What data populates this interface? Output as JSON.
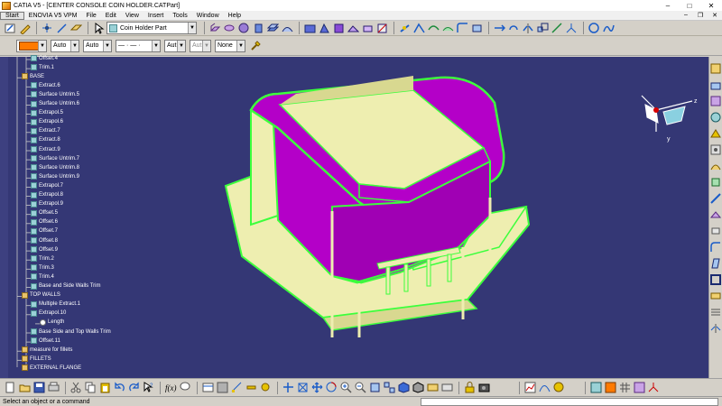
{
  "titlebar": {
    "title": "CATIA V5 - [CENTER CONSOLE COIN HOLDER.CATPart]",
    "minimize": "–",
    "maximize": "□",
    "close": "✕"
  },
  "menubar": {
    "items": [
      "Start",
      "ENOVIA V5 VPM",
      "File",
      "Edit",
      "View",
      "Insert",
      "Tools",
      "Window",
      "Help"
    ],
    "mdi_minimize": "–",
    "mdi_restore": "❐",
    "mdi_close": "✕"
  },
  "toolbar": {
    "part_combo_value": "Coin Holder Part"
  },
  "properties_bar": {
    "color_value": "",
    "transparency_value": "Auto",
    "line_weight_value": "Auto",
    "line_type_value": "— · — ·",
    "point_symbol_value": "Aut",
    "rendering_value": "Aut",
    "layer_value": "None"
  },
  "tree": {
    "nodes": [
      {
        "label": "Offset.4",
        "type": "feat"
      },
      {
        "label": "Trim.1",
        "type": "feat"
      },
      {
        "label": "BASE",
        "type": "set"
      },
      {
        "label": "Extract.6",
        "type": "feat"
      },
      {
        "label": "Surface Untrim.5",
        "type": "feat"
      },
      {
        "label": "Surface Untrim.6",
        "type": "feat"
      },
      {
        "label": "Extrapol.5",
        "type": "feat"
      },
      {
        "label": "Extrapol.6",
        "type": "feat"
      },
      {
        "label": "Extract.7",
        "type": "feat"
      },
      {
        "label": "Extract.8",
        "type": "feat"
      },
      {
        "label": "Extract.9",
        "type": "feat"
      },
      {
        "label": "Surface Untrim.7",
        "type": "feat"
      },
      {
        "label": "Surface Untrim.8",
        "type": "feat"
      },
      {
        "label": "Surface Untrim.9",
        "type": "feat"
      },
      {
        "label": "Extrapol.7",
        "type": "feat"
      },
      {
        "label": "Extrapol.8",
        "type": "feat"
      },
      {
        "label": "Extrapol.9",
        "type": "feat"
      },
      {
        "label": "Offset.5",
        "type": "feat"
      },
      {
        "label": "Offset.6",
        "type": "feat"
      },
      {
        "label": "Offset.7",
        "type": "feat"
      },
      {
        "label": "Offset.8",
        "type": "feat"
      },
      {
        "label": "Offset.9",
        "type": "feat"
      },
      {
        "label": "Trim.2",
        "type": "feat"
      },
      {
        "label": "Trim.3",
        "type": "feat"
      },
      {
        "label": "Trim.4",
        "type": "feat"
      },
      {
        "label": "Base and Side Walls Trim",
        "type": "feat"
      },
      {
        "label": "TOP WALLS",
        "type": "set"
      },
      {
        "label": "Multiple Extract.1",
        "type": "feat"
      },
      {
        "label": "Extrapol.10",
        "type": "feat"
      },
      {
        "label": "Length",
        "type": "param"
      },
      {
        "label": "Base Side and Top Walls Trim",
        "type": "feat"
      },
      {
        "label": "Offset.11",
        "type": "feat"
      },
      {
        "label": "measure for fillets",
        "type": "set"
      },
      {
        "label": "FILLETS",
        "type": "set"
      },
      {
        "label": "EXTERNAL FLANGE",
        "type": "set"
      }
    ]
  },
  "compass": {
    "axis_y_label": "y",
    "axis_z_label": "z"
  },
  "statusbar": {
    "message": "Select an object or a command"
  },
  "colors": {
    "viewport_background": "#343775",
    "surface_magenta": "#b400c8",
    "surface_cream": "#eeeeb0",
    "edge_green": "#3cff3c"
  }
}
